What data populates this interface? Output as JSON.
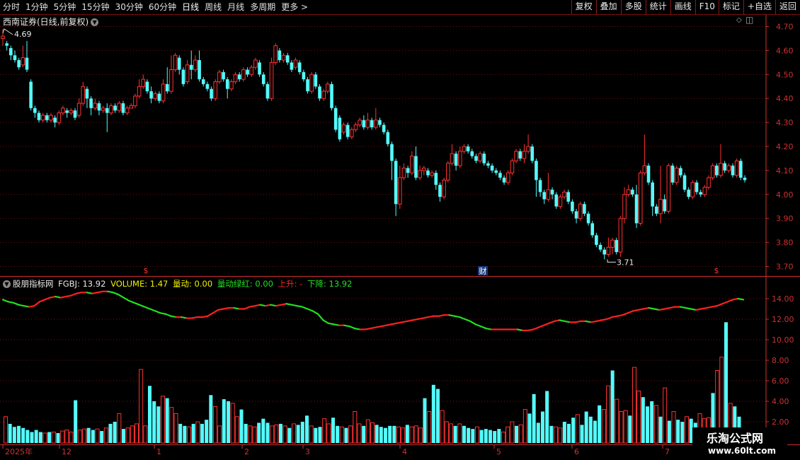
{
  "toolbar": {
    "periods": [
      "分时",
      "1分钟",
      "5分钟",
      "15分钟",
      "30分钟",
      "60分钟",
      "日线",
      "周线",
      "月线",
      "多周期",
      "更多 >"
    ],
    "active": "日线",
    "actions": [
      "复权",
      "叠加",
      "多股",
      "统计",
      "画线",
      "F10",
      "标记",
      "+自选",
      "返回"
    ]
  },
  "stock": {
    "title": "西南证券(日线,前复权)"
  },
  "price_axis": {
    "ticks": [
      "4.70",
      "4.60",
      "4.50",
      "4.40",
      "4.30",
      "4.20",
      "4.10",
      "4.00",
      "3.90",
      "3.80",
      "3.70"
    ],
    "min": 3.7,
    "max": 4.7
  },
  "annotations": {
    "high_label": "4.69",
    "low_label": "3.71",
    "event_markers": [
      "$",
      "财",
      "$"
    ]
  },
  "indicator": {
    "name": "股朋指标网",
    "fgbj_label": "FGBJ: 13.92",
    "volume_label": "VOLUME: 1.47",
    "liangdong_label": "量动: 0.00",
    "lvhong_label": "量动绿红: 0.00",
    "up_label": "上升: -",
    "down_label": "下降: 13.92",
    "axis_ticks": [
      "14.00",
      "12.00",
      "10.00",
      "8.00",
      "6.00",
      "4.00",
      "2.00"
    ],
    "min": 0,
    "max": 15
  },
  "time_axis": {
    "labels": [
      "2025年",
      "12",
      "1",
      "2",
      "3",
      "4",
      "5",
      "6",
      "7"
    ]
  },
  "watermark": {
    "line1": "乐淘公式网",
    "line2": "www.60lt.com"
  },
  "colors": {
    "up": "#ff3232",
    "down": "#54fcfc",
    "grid": "#7a1010",
    "axis": "#d03030",
    "line_up": "#ff2020",
    "line_down": "#20e020"
  },
  "chart_data": {
    "type": "candlestick",
    "candles": [
      [
        4.65,
        4.66,
        4.69,
        4.62
      ],
      [
        4.63,
        4.62,
        4.64,
        4.6
      ],
      [
        4.61,
        4.58,
        4.62,
        4.56
      ],
      [
        4.58,
        4.56,
        4.6,
        4.55
      ],
      [
        4.56,
        4.53,
        4.57,
        4.52
      ],
      [
        4.54,
        4.57,
        4.62,
        4.53
      ],
      [
        4.57,
        4.52,
        4.64,
        4.51
      ],
      [
        4.47,
        4.36,
        4.48,
        4.35
      ],
      [
        4.36,
        4.34,
        4.37,
        4.32
      ],
      [
        4.34,
        4.31,
        4.35,
        4.3
      ],
      [
        4.31,
        4.33,
        4.34,
        4.3
      ],
      [
        4.33,
        4.31,
        4.34,
        4.3
      ],
      [
        4.31,
        4.33,
        4.34,
        4.3
      ],
      [
        4.32,
        4.3,
        4.33,
        4.28
      ],
      [
        4.3,
        4.34,
        4.35,
        4.29
      ],
      [
        4.34,
        4.36,
        4.37,
        4.33
      ],
      [
        4.35,
        4.34,
        4.36,
        4.32
      ],
      [
        4.34,
        4.35,
        4.36,
        4.33
      ],
      [
        4.35,
        4.32,
        4.36,
        4.31
      ],
      [
        4.33,
        4.38,
        4.4,
        4.32
      ],
      [
        4.38,
        4.45,
        4.47,
        4.37
      ],
      [
        4.44,
        4.4,
        4.45,
        4.36
      ],
      [
        4.4,
        4.36,
        4.41,
        4.33
      ],
      [
        4.36,
        4.38,
        4.4,
        4.35
      ],
      [
        4.38,
        4.35,
        4.39,
        4.33
      ],
      [
        4.35,
        4.36,
        4.37,
        4.34
      ],
      [
        4.36,
        4.34,
        4.38,
        4.26
      ],
      [
        4.34,
        4.37,
        4.38,
        4.33
      ],
      [
        4.37,
        4.35,
        4.38,
        4.34
      ],
      [
        4.35,
        4.38,
        4.39,
        4.34
      ],
      [
        4.38,
        4.34,
        4.39,
        4.33
      ],
      [
        4.34,
        4.36,
        4.37,
        4.33
      ],
      [
        4.36,
        4.37,
        4.38,
        4.36
      ],
      [
        4.37,
        4.41,
        4.42,
        4.36
      ],
      [
        4.41,
        4.45,
        4.48,
        4.4
      ],
      [
        4.45,
        4.48,
        4.5,
        4.44
      ],
      [
        4.47,
        4.43,
        4.48,
        4.42
      ],
      [
        4.43,
        4.4,
        4.45,
        4.38
      ],
      [
        4.4,
        4.42,
        4.43,
        4.39
      ],
      [
        4.42,
        4.39,
        4.43,
        4.38
      ],
      [
        4.39,
        4.46,
        4.48,
        4.38
      ],
      [
        4.46,
        4.43,
        4.53,
        4.42
      ],
      [
        4.43,
        4.52,
        4.58,
        4.42
      ],
      [
        4.52,
        4.58,
        4.59,
        4.51
      ],
      [
        4.57,
        4.52,
        4.58,
        4.5
      ],
      [
        4.52,
        4.46,
        4.53,
        4.45
      ],
      [
        4.47,
        4.54,
        4.56,
        4.46
      ],
      [
        4.54,
        4.52,
        4.6,
        4.48
      ],
      [
        4.52,
        4.56,
        4.58,
        4.51
      ],
      [
        4.56,
        4.48,
        4.6,
        4.47
      ],
      [
        4.48,
        4.46,
        4.49,
        4.45
      ],
      [
        4.46,
        4.44,
        4.47,
        4.43
      ],
      [
        4.44,
        4.4,
        4.45,
        4.39
      ],
      [
        4.4,
        4.47,
        4.48,
        4.39
      ],
      [
        4.47,
        4.51,
        4.52,
        4.46
      ],
      [
        4.51,
        4.48,
        4.52,
        4.47
      ],
      [
        4.48,
        4.44,
        4.49,
        4.4
      ],
      [
        4.44,
        4.47,
        4.48,
        4.43
      ],
      [
        4.47,
        4.5,
        4.51,
        4.46
      ],
      [
        4.5,
        4.48,
        4.51,
        4.47
      ],
      [
        4.48,
        4.52,
        4.53,
        4.47
      ],
      [
        4.52,
        4.5,
        4.53,
        4.49
      ],
      [
        4.5,
        4.53,
        4.54,
        4.49
      ],
      [
        4.53,
        4.56,
        4.57,
        4.52
      ],
      [
        4.55,
        4.5,
        4.56,
        4.49
      ],
      [
        4.5,
        4.46,
        4.51,
        4.45
      ],
      [
        4.46,
        4.4,
        4.47,
        4.39
      ],
      [
        4.4,
        4.55,
        4.57,
        4.39
      ],
      [
        4.55,
        4.62,
        4.63,
        4.54
      ],
      [
        4.6,
        4.56,
        4.61,
        4.55
      ],
      [
        4.56,
        4.58,
        4.59,
        4.55
      ],
      [
        4.58,
        4.55,
        4.59,
        4.54
      ],
      [
        4.55,
        4.52,
        4.56,
        4.51
      ],
      [
        4.53,
        4.56,
        4.57,
        4.52
      ],
      [
        4.55,
        4.51,
        4.56,
        4.5
      ],
      [
        4.51,
        4.48,
        4.52,
        4.47
      ],
      [
        4.48,
        4.43,
        4.49,
        4.42
      ],
      [
        4.43,
        4.5,
        4.51,
        4.42
      ],
      [
        4.5,
        4.45,
        4.51,
        4.44
      ],
      [
        4.45,
        4.4,
        4.46,
        4.39
      ],
      [
        4.4,
        4.43,
        4.44,
        4.39
      ],
      [
        4.43,
        4.46,
        4.47,
        4.42
      ],
      [
        4.46,
        4.36,
        4.47,
        4.35
      ],
      [
        4.36,
        4.27,
        4.37,
        4.26
      ],
      [
        4.32,
        4.23,
        4.33,
        4.22
      ],
      [
        4.26,
        4.29,
        4.3,
        4.25
      ],
      [
        4.29,
        4.24,
        4.3,
        4.23
      ],
      [
        4.24,
        4.27,
        4.28,
        4.23
      ],
      [
        4.27,
        4.29,
        4.3,
        4.26
      ],
      [
        4.29,
        4.31,
        4.32,
        4.28
      ],
      [
        4.31,
        4.28,
        4.33,
        4.27
      ],
      [
        4.28,
        4.31,
        4.34,
        4.27
      ],
      [
        4.31,
        4.28,
        4.32,
        4.27
      ],
      [
        4.28,
        4.31,
        4.36,
        4.27
      ],
      [
        4.31,
        4.29,
        4.32,
        4.28
      ],
      [
        4.29,
        4.26,
        4.3,
        4.25
      ],
      [
        4.26,
        4.21,
        4.27,
        4.2
      ],
      [
        4.21,
        4.14,
        4.22,
        4.06
      ],
      [
        4.14,
        3.96,
        4.15,
        3.91
      ],
      [
        3.96,
        4.07,
        4.12,
        3.94
      ],
      [
        4.07,
        4.11,
        4.13,
        4.06
      ],
      [
        4.11,
        4.09,
        4.12,
        4.07
      ],
      [
        4.09,
        4.16,
        4.18,
        4.08
      ],
      [
        4.16,
        4.07,
        4.2,
        4.06
      ],
      [
        4.07,
        4.1,
        4.12,
        4.06
      ],
      [
        4.1,
        4.11,
        4.12,
        4.08
      ],
      [
        4.1,
        4.08,
        4.11,
        4.07
      ],
      [
        4.08,
        4.09,
        4.1,
        4.07
      ],
      [
        4.09,
        4.04,
        4.1,
        4.02
      ],
      [
        4.04,
        3.99,
        4.05,
        3.97
      ],
      [
        3.99,
        4.06,
        4.07,
        3.98
      ],
      [
        4.06,
        4.13,
        4.14,
        4.05
      ],
      [
        4.13,
        4.17,
        4.21,
        4.12
      ],
      [
        4.17,
        4.12,
        4.18,
        4.1
      ],
      [
        4.12,
        4.18,
        4.2,
        4.11
      ],
      [
        4.18,
        4.2,
        4.21,
        4.17
      ],
      [
        4.2,
        4.18,
        4.21,
        4.17
      ],
      [
        4.18,
        4.16,
        4.19,
        4.15
      ],
      [
        4.16,
        4.14,
        4.17,
        4.13
      ],
      [
        4.14,
        4.17,
        4.18,
        4.13
      ],
      [
        4.17,
        4.13,
        4.18,
        4.12
      ],
      [
        4.13,
        4.12,
        4.14,
        4.11
      ],
      [
        4.12,
        4.1,
        4.13,
        4.09
      ],
      [
        4.1,
        4.09,
        4.11,
        4.08
      ],
      [
        4.09,
        4.07,
        4.1,
        4.06
      ],
      [
        4.07,
        4.05,
        4.08,
        4.04
      ],
      [
        4.05,
        4.09,
        4.1,
        4.04
      ],
      [
        4.09,
        4.14,
        4.15,
        4.08
      ],
      [
        4.14,
        4.18,
        4.19,
        4.13
      ],
      [
        4.18,
        4.15,
        4.19,
        4.14
      ],
      [
        4.15,
        4.18,
        4.21,
        4.13
      ],
      [
        4.18,
        4.2,
        4.25,
        4.17
      ],
      [
        4.2,
        4.14,
        4.21,
        4.13
      ],
      [
        4.14,
        4.06,
        4.15,
        3.99
      ],
      [
        4.06,
        4.01,
        4.07,
        3.99
      ],
      [
        4.01,
        3.98,
        4.02,
        3.96
      ],
      [
        3.98,
        4.02,
        4.09,
        3.97
      ],
      [
        4.02,
        4.0,
        4.03,
        3.98
      ],
      [
        4.0,
        3.95,
        4.01,
        3.94
      ],
      [
        3.95,
        3.99,
        4.0,
        3.94
      ],
      [
        3.99,
        4.01,
        4.02,
        3.98
      ],
      [
        4.01,
        3.97,
        4.02,
        3.96
      ],
      [
        3.97,
        3.93,
        3.98,
        3.92
      ],
      [
        3.93,
        3.9,
        3.94,
        3.88
      ],
      [
        3.9,
        3.96,
        3.97,
        3.89
      ],
      [
        3.96,
        3.92,
        3.97,
        3.91
      ],
      [
        3.92,
        3.88,
        3.93,
        3.87
      ],
      [
        3.88,
        3.83,
        3.89,
        3.82
      ],
      [
        3.83,
        3.79,
        3.84,
        3.78
      ],
      [
        3.79,
        3.77,
        3.8,
        3.76
      ],
      [
        3.77,
        3.75,
        3.78,
        3.73
      ],
      [
        3.75,
        3.78,
        3.82,
        3.74
      ],
      [
        3.78,
        3.81,
        3.82,
        3.75
      ],
      [
        3.81,
        3.76,
        3.82,
        3.75
      ],
      [
        3.76,
        3.9,
        3.91,
        3.74
      ],
      [
        3.9,
        4.0,
        4.03,
        3.88
      ],
      [
        4.0,
        4.02,
        4.04,
        3.99
      ],
      [
        4.02,
        4.0,
        4.03,
        3.99
      ],
      [
        4.0,
        3.88,
        4.04,
        3.86
      ],
      [
        3.88,
        4.09,
        4.1,
        3.87
      ],
      [
        4.09,
        4.12,
        4.25,
        4.08
      ],
      [
        4.12,
        4.05,
        4.13,
        4.04
      ],
      [
        4.05,
        3.95,
        4.06,
        3.91
      ],
      [
        3.95,
        3.92,
        3.96,
        3.91
      ],
      [
        3.92,
        3.98,
        4.12,
        3.88
      ],
      [
        3.98,
        3.93,
        4.0,
        3.92
      ],
      [
        3.93,
        4.12,
        4.13,
        3.92
      ],
      [
        4.12,
        4.05,
        4.13,
        4.04
      ],
      [
        4.05,
        4.11,
        4.12,
        4.04
      ],
      [
        4.11,
        4.08,
        4.12,
        4.07
      ],
      [
        4.08,
        4.02,
        4.09,
        4.01
      ],
      [
        4.02,
        3.99,
        4.03,
        3.98
      ],
      [
        3.99,
        4.05,
        4.06,
        3.98
      ],
      [
        4.05,
        4.01,
        4.06,
        4.0
      ],
      [
        4.01,
        4.0,
        4.02,
        3.99
      ],
      [
        4.0,
        4.03,
        4.04,
        3.99
      ],
      [
        4.03,
        4.07,
        4.08,
        4.02
      ],
      [
        4.07,
        4.12,
        4.13,
        4.06
      ],
      [
        4.12,
        4.08,
        4.13,
        4.07
      ],
      [
        4.08,
        4.13,
        4.21,
        4.07
      ],
      [
        4.13,
        4.1,
        4.14,
        4.09
      ],
      [
        4.1,
        4.12,
        4.13,
        4.09
      ],
      [
        4.12,
        4.08,
        4.13,
        4.07
      ],
      [
        4.08,
        4.14,
        4.15,
        4.07
      ],
      [
        4.14,
        4.07,
        4.15,
        4.06
      ],
      [
        4.07,
        4.06,
        4.08,
        4.05
      ]
    ],
    "fgbj": [
      13.9,
      13.7,
      13.6,
      13.4,
      13.3,
      13.2,
      13.3,
      13.7,
      13.9,
      14.1,
      14.2,
      14.1,
      14.2,
      14.3,
      14.5,
      14.6,
      14.6,
      14.5,
      14.6,
      14.7,
      14.7,
      14.6,
      14.4,
      14.1,
      13.8,
      13.6,
      13.4,
      13.2,
      13.0,
      12.8,
      12.6,
      12.5,
      12.3,
      12.2,
      12.2,
      12.1,
      12.1,
      12.2,
      12.2,
      12.3,
      12.6,
      12.9,
      13.0,
      13.1,
      13.1,
      13.0,
      13.0,
      13.2,
      13.3,
      13.4,
      13.3,
      13.4,
      13.3,
      13.4,
      13.5,
      13.4,
      13.3,
      13.2,
      13.0,
      12.8,
      12.5,
      11.9,
      11.6,
      11.5,
      11.4,
      11.4,
      11.3,
      11.1,
      11.0,
      11.0,
      11.1,
      11.2,
      11.3,
      11.4,
      11.5,
      11.6,
      11.7,
      11.8,
      11.9,
      12.0,
      12.1,
      12.2,
      12.3,
      12.3,
      12.4,
      12.4,
      12.3,
      12.2,
      12.0,
      11.8,
      11.5,
      11.3,
      11.1,
      11.0,
      11.0,
      11.0,
      11.0,
      11.0,
      11.0,
      10.9,
      10.9,
      11.0,
      11.2,
      11.4,
      11.6,
      11.8,
      11.9,
      11.8,
      11.7,
      11.7,
      11.8,
      11.8,
      11.7,
      11.8,
      11.9,
      12.0,
      12.2,
      12.3,
      12.4,
      12.6,
      12.8,
      12.9,
      13.0,
      13.1,
      13.0,
      12.9,
      13.0,
      13.1,
      13.2,
      13.2,
      13.1,
      13.0,
      12.9,
      13.0,
      13.1,
      13.2,
      13.3,
      13.5,
      13.7,
      13.9,
      14.0,
      13.9
    ],
    "volume": [
      2.5,
      1.8,
      1.5,
      1.6,
      1.4,
      1.2,
      1.0,
      1.2,
      1.0,
      0.9,
      1.0,
      1.0,
      0.9,
      1.1,
      1.2,
      1.0,
      4.1,
      1.2,
      1.3,
      1.4,
      1.2,
      1.3,
      1.1,
      1.4,
      1.8,
      2.0,
      2.8,
      1.3,
      1.4,
      1.6,
      1.8,
      7.1,
      1.6,
      5.5,
      4.0,
      3.5,
      4.5,
      4.3,
      3.4,
      2.8,
      1.8,
      1.6,
      1.5,
      1.8,
      2.0,
      1.8,
      2.2,
      4.6,
      3.5,
      1.6,
      4.2,
      4.0,
      3.8,
      2.5,
      3.2,
      1.8,
      1.6,
      1.5,
      1.9,
      2.3,
      1.9,
      1.6,
      1.7,
      1.8,
      1.6,
      1.4,
      1.8,
      1.7,
      2.0,
      2.6,
      1.6,
      1.4,
      1.5,
      2.3,
      1.8,
      2.4,
      1.6,
      1.5,
      1.4,
      1.6,
      3.0,
      1.8,
      1.6,
      2.2,
      1.9,
      1.7,
      1.5,
      1.4,
      1.6,
      1.6,
      1.5,
      1.4,
      1.7,
      1.5,
      1.6,
      1.4,
      4.3,
      3.0,
      5.6,
      5.2,
      3.1,
      2.0,
      1.8,
      1.6,
      1.8,
      1.6,
      1.4,
      1.3,
      1.5,
      1.2,
      1.3,
      1.2,
      1.1,
      1.3,
      1.0,
      1.5,
      2.0,
      1.6,
      1.7,
      3.2,
      2.8,
      4.7,
      1.9,
      3.0,
      5.0,
      1.6,
      1.5,
      1.4,
      2.0,
      1.8,
      2.4,
      2.7,
      1.7,
      3.0,
      2.5,
      2.1,
      3.6,
      3.2,
      5.5,
      7.0,
      4.2,
      3.0,
      3.1,
      2.6,
      7.3,
      5.0,
      4.4,
      3.5,
      4.0,
      3.6,
      2.5,
      5.3,
      2.1,
      3.0,
      2.2,
      2.0,
      2.5,
      2.3,
      1.9,
      2.8,
      2.3,
      2.4,
      4.8,
      7.0,
      8.3,
      11.7,
      3.8,
      3.5,
      2.5
    ]
  }
}
